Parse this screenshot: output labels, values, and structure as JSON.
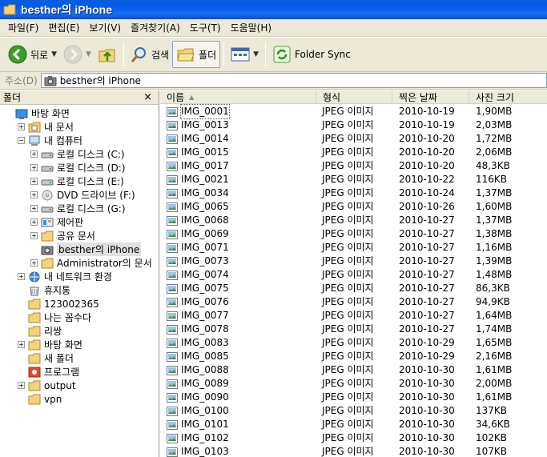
{
  "window": {
    "title": "besther의 iPhone"
  },
  "menu": [
    "파일(F)",
    "편집(E)",
    "보기(V)",
    "즐겨찾기(A)",
    "도구(T)",
    "도움말(H)"
  ],
  "toolbar": {
    "back": "뒤로",
    "search": "검색",
    "folders": "폴더",
    "sync": "Folder Sync"
  },
  "address": {
    "label": "주소(D)",
    "value": "besther의 iPhone"
  },
  "left_pane": {
    "title": "폴더",
    "close": "×",
    "tree": [
      {
        "label": "바탕 화면",
        "icon": "desktop-icon",
        "exp": "",
        "indent": 0
      },
      {
        "label": "내 문서",
        "icon": "my-documents-icon",
        "exp": "+",
        "indent": 1
      },
      {
        "label": "내 컴퓨터",
        "icon": "my-computer-icon",
        "exp": "-",
        "indent": 1
      },
      {
        "label": "로컬 디스크 (C:)",
        "icon": "disk-icon",
        "exp": "+",
        "indent": 2
      },
      {
        "label": "로컬 디스크 (D:)",
        "icon": "disk-icon",
        "exp": "+",
        "indent": 2
      },
      {
        "label": "로컬 디스크 (E:)",
        "icon": "disk-icon",
        "exp": "+",
        "indent": 2
      },
      {
        "label": "DVD 드라이브 (F:)",
        "icon": "dvd-icon",
        "exp": "+",
        "indent": 2
      },
      {
        "label": "로컬 디스크 (G:)",
        "icon": "disk-icon",
        "exp": "+",
        "indent": 2
      },
      {
        "label": "제어판",
        "icon": "control-panel-icon",
        "exp": "+",
        "indent": 2
      },
      {
        "label": "공유 문서",
        "icon": "folder-icon",
        "exp": "+",
        "indent": 2
      },
      {
        "label": "besther의 iPhone",
        "icon": "camera-icon",
        "exp": "",
        "indent": 2,
        "selected": true
      },
      {
        "label": "Administrator의 문서",
        "icon": "folder-icon",
        "exp": "+",
        "indent": 2
      },
      {
        "label": "내 네트워크 환경",
        "icon": "network-icon",
        "exp": "+",
        "indent": 1
      },
      {
        "label": "휴지통",
        "icon": "recycle-bin-icon",
        "exp": "",
        "indent": 1
      },
      {
        "label": "123002365",
        "icon": "folder-icon",
        "exp": "",
        "indent": 1
      },
      {
        "label": "나는 꼼수다",
        "icon": "folder-icon",
        "exp": "",
        "indent": 1
      },
      {
        "label": "리쌍",
        "icon": "folder-icon",
        "exp": "",
        "indent": 1
      },
      {
        "label": "바탕 화면",
        "icon": "folder-icon",
        "exp": "+",
        "indent": 1
      },
      {
        "label": "새 폴더",
        "icon": "folder-icon",
        "exp": "",
        "indent": 1
      },
      {
        "label": "프로그램",
        "icon": "program-icon",
        "exp": "",
        "indent": 1
      },
      {
        "label": "output",
        "icon": "folder-icon",
        "exp": "+",
        "indent": 1
      },
      {
        "label": "vpn",
        "icon": "folder-icon",
        "exp": "",
        "indent": 1
      }
    ]
  },
  "columns": {
    "name": "이름",
    "type": "형식",
    "date": "찍은 날짜",
    "size": "사진 크기"
  },
  "files": [
    {
      "name": "IMG_0001",
      "type": "JPEG 이미지",
      "date": "2010-10-19",
      "size": "1,90MB"
    },
    {
      "name": "IMG_0013",
      "type": "JPEG 이미지",
      "date": "2010-10-19",
      "size": "2,03MB"
    },
    {
      "name": "IMG_0014",
      "type": "JPEG 이미지",
      "date": "2010-10-20",
      "size": "1,72MB"
    },
    {
      "name": "IMG_0015",
      "type": "JPEG 이미지",
      "date": "2010-10-20",
      "size": "2,06MB"
    },
    {
      "name": "IMG_0017",
      "type": "JPEG 이미지",
      "date": "2010-10-20",
      "size": "48,3KB"
    },
    {
      "name": "IMG_0021",
      "type": "JPEG 이미지",
      "date": "2010-10-22",
      "size": "116KB"
    },
    {
      "name": "IMG_0034",
      "type": "JPEG 이미지",
      "date": "2010-10-24",
      "size": "1,37MB"
    },
    {
      "name": "IMG_0065",
      "type": "JPEG 이미지",
      "date": "2010-10-26",
      "size": "1,60MB"
    },
    {
      "name": "IMG_0068",
      "type": "JPEG 이미지",
      "date": "2010-10-27",
      "size": "1,37MB"
    },
    {
      "name": "IMG_0069",
      "type": "JPEG 이미지",
      "date": "2010-10-27",
      "size": "1,38MB"
    },
    {
      "name": "IMG_0071",
      "type": "JPEG 이미지",
      "date": "2010-10-27",
      "size": "1,16MB"
    },
    {
      "name": "IMG_0073",
      "type": "JPEG 이미지",
      "date": "2010-10-27",
      "size": "1,39MB"
    },
    {
      "name": "IMG_0074",
      "type": "JPEG 이미지",
      "date": "2010-10-27",
      "size": "1,48MB"
    },
    {
      "name": "IMG_0075",
      "type": "JPEG 이미지",
      "date": "2010-10-27",
      "size": "86,3KB"
    },
    {
      "name": "IMG_0076",
      "type": "JPEG 이미지",
      "date": "2010-10-27",
      "size": "94,9KB"
    },
    {
      "name": "IMG_0077",
      "type": "JPEG 이미지",
      "date": "2010-10-27",
      "size": "1,64MB"
    },
    {
      "name": "IMG_0078",
      "type": "JPEG 이미지",
      "date": "2010-10-27",
      "size": "1,74MB"
    },
    {
      "name": "IMG_0083",
      "type": "JPEG 이미지",
      "date": "2010-10-29",
      "size": "1,65MB"
    },
    {
      "name": "IMG_0085",
      "type": "JPEG 이미지",
      "date": "2010-10-29",
      "size": "2,16MB"
    },
    {
      "name": "IMG_0088",
      "type": "JPEG 이미지",
      "date": "2010-10-30",
      "size": "1,61MB"
    },
    {
      "name": "IMG_0089",
      "type": "JPEG 이미지",
      "date": "2010-10-30",
      "size": "2,00MB"
    },
    {
      "name": "IMG_0090",
      "type": "JPEG 이미지",
      "date": "2010-10-30",
      "size": "1,61MB"
    },
    {
      "name": "IMG_0100",
      "type": "JPEG 이미지",
      "date": "2010-10-30",
      "size": "137KB"
    },
    {
      "name": "IMG_0101",
      "type": "JPEG 이미지",
      "date": "2010-10-30",
      "size": "34,6KB"
    },
    {
      "name": "IMG_0102",
      "type": "JPEG 이미지",
      "date": "2010-10-30",
      "size": "102KB"
    },
    {
      "name": "IMG_0103",
      "type": "JPEG 이미지",
      "date": "2010-10-30",
      "size": "107KB"
    }
  ]
}
